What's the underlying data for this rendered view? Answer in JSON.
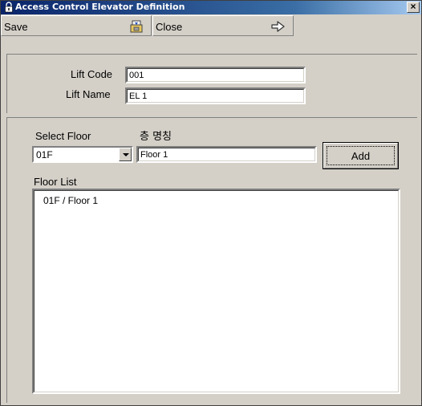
{
  "window": {
    "title": "Access Control Elevator Definition",
    "close_glyph": "×"
  },
  "toolbar": {
    "save_label": "Save",
    "save_icon": "save-disk-icon",
    "close_label": "Close",
    "close_icon": "exit-arrow-icon"
  },
  "form": {
    "lift_code_label": "Lift Code",
    "lift_code_value": "001",
    "lift_name_label": "Lift Name",
    "lift_name_value": "EL 1"
  },
  "floor": {
    "select_floor_label": "Select Floor",
    "floor_name_label": "층 명칭",
    "selected_floor": "01F",
    "floor_name_value": "Floor 1",
    "add_label": "Add"
  },
  "floor_list": {
    "label": "Floor List",
    "items": [
      "01F / Floor 1"
    ]
  },
  "colors": {
    "face": "#d4d0c8",
    "title_start": "#0a246a",
    "title_end": "#a6caf0"
  }
}
